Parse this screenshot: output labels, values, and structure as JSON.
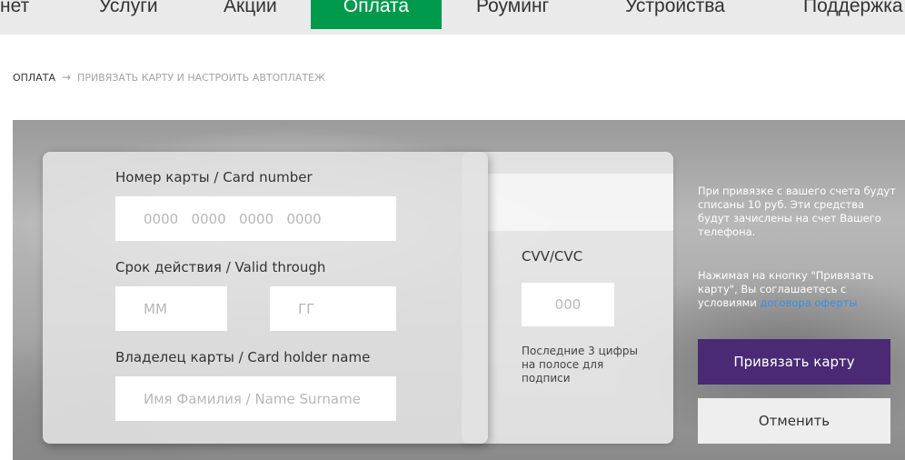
{
  "nav": {
    "items": [
      {
        "label": "нет"
      },
      {
        "label": "Услуги"
      },
      {
        "label": "Акции"
      },
      {
        "label": "Оплата"
      },
      {
        "label": "Роуминг"
      },
      {
        "label": "Устройства"
      },
      {
        "label": "Поддержка"
      }
    ],
    "active_index": 3,
    "active_color": "#009a4d"
  },
  "breadcrumb": {
    "home": "ОПЛАТА",
    "arrow": "→",
    "current": "ПРИВЯЗАТЬ КАРТУ И НАСТРОИТЬ АВТОПЛАТЕЖ"
  },
  "form": {
    "card_number_label": "Номер карты / Card number",
    "card_number_placeholder": "0000   0000   0000   0000",
    "card_number_value": "",
    "valid_label": "Срок действия / Valid through",
    "month_placeholder": "ММ",
    "year_placeholder": "ГГ",
    "holder_label": "Владелец карты / Card holder name",
    "holder_placeholder": "Имя Фамилия / Name Surname",
    "cvv_label": "CVV/CVC",
    "cvv_placeholder": "000",
    "cvv_hint": "Последние 3 цифры на полосе для подписи"
  },
  "info": {
    "notice": "При привязке с вашего счета будут списаны 10 руб. Эти средства будут зачислены на счет Вашего телефона.",
    "agreement_prefix": "Нажимая на кнопку \"Привязать карту\", Вы соглашаетесь с условиями ",
    "agreement_link": "договора оферты",
    "link_color": "#3a8ee6"
  },
  "buttons": {
    "bind_label": "Привязать карту",
    "cancel_label": "Отменить",
    "bind_color": "#4a2a74"
  }
}
